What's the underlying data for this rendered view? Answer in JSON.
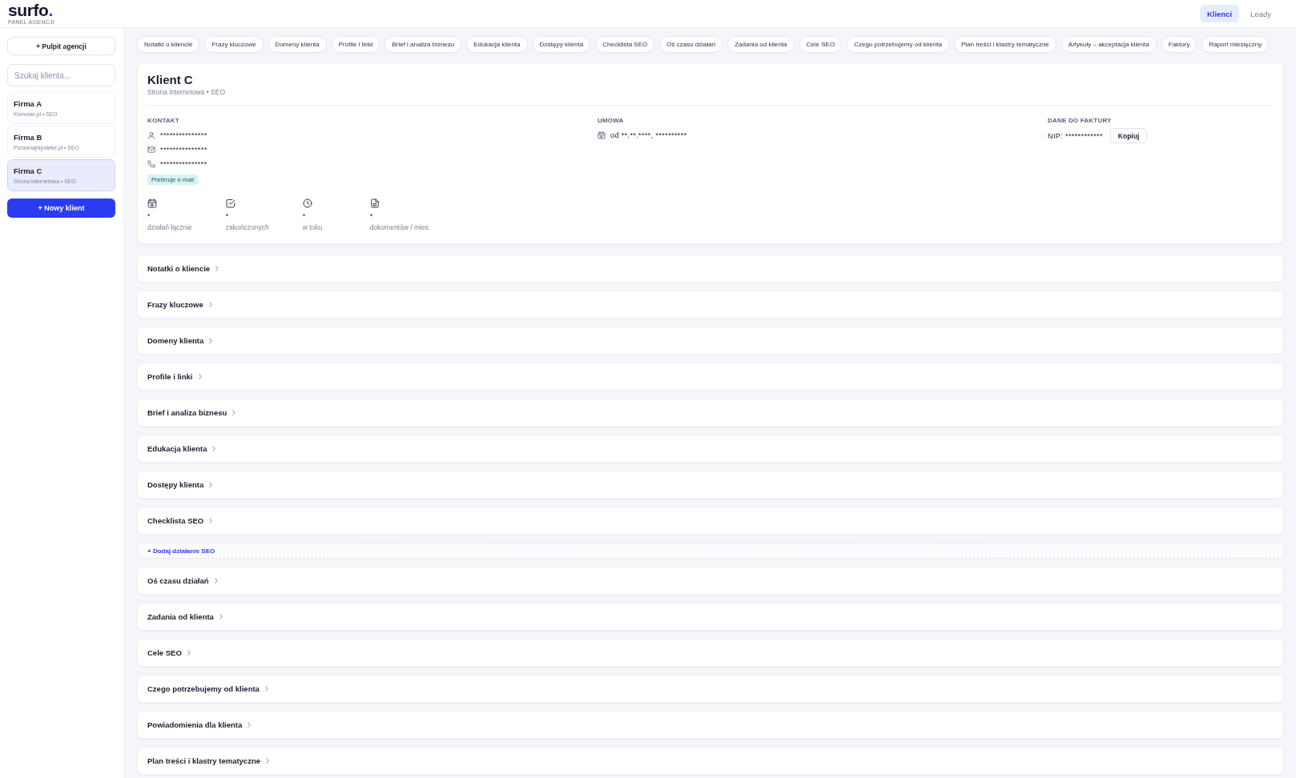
{
  "brand": {
    "name": "surfo",
    "dot": ".",
    "subtitle": "PANEL AGENCJI"
  },
  "top_nav": [
    {
      "label": "Klienci",
      "selected": true
    },
    {
      "label": "Leady",
      "selected": false
    }
  ],
  "sidebar": {
    "dashboard_button": "+ Pulpit agencji",
    "search": {
      "placeholder": "Szukaj klienta..."
    },
    "clients": [
      {
        "name": "Firma A",
        "subtitle": "Kronowo.pl • SEO",
        "selected": false
      },
      {
        "name": "Firma B",
        "subtitle": "Porównajhipoteke.pl • SEO",
        "selected": false
      },
      {
        "name": "Firma C",
        "subtitle": "Strona internetowa • SEO",
        "selected": true
      }
    ],
    "new_client_button": "+ Nowy klient"
  },
  "section_tabs": [
    "Notatki o kliencie",
    "Frazy kluczowe",
    "Domeny klienta",
    "Profile i linki",
    "Brief i analiza biznesu",
    "Edukacja klienta",
    "Dostępy klienta",
    "Checklista SEO",
    "Oś czasu działań",
    "Zadania od klienta",
    "Cele SEO",
    "Czego potrzebujemy od klienta",
    "Plan treści i klastry tematyczne",
    "Artykuły – akceptacja klienta",
    "Faktury",
    "Raport miesięczny"
  ],
  "client": {
    "name": "Klient C",
    "subtitle": "Strona internetowa • SEO",
    "contact": {
      "heading": "KONTAKT",
      "rows": [
        {
          "kind": "person",
          "value": "***************"
        },
        {
          "kind": "email",
          "value": "***************"
        },
        {
          "kind": "phone",
          "value": "***************"
        }
      ],
      "preference_badge": "Preferuje e-mail"
    },
    "contract": {
      "heading": "UMOWA",
      "value": "od **.**.****, **********"
    },
    "invoice": {
      "heading": "DANE DO FAKTURY",
      "nip": "NIP: ************",
      "copy_button": "Kopiuj"
    },
    "stats": [
      {
        "kind": "calendar",
        "value": "*",
        "label": "działań łącznie"
      },
      {
        "kind": "check",
        "value": "*",
        "label": "zakończonych"
      },
      {
        "kind": "clock",
        "value": "*",
        "label": "w toku"
      },
      {
        "kind": "document",
        "value": "*",
        "label": "dokumentów / mies."
      }
    ]
  },
  "sections": [
    {
      "kind": "section",
      "title": "Notatki o kliencie"
    },
    {
      "kind": "section",
      "title": "Frazy kluczowe"
    },
    {
      "kind": "section",
      "title": "Domeny klienta"
    },
    {
      "kind": "section",
      "title": "Profile i linki"
    },
    {
      "kind": "section",
      "title": "Brief i analiza biznesu"
    },
    {
      "kind": "section",
      "title": "Edukacja klienta"
    },
    {
      "kind": "section",
      "title": "Dostępy klienta"
    },
    {
      "kind": "section",
      "title": "Checklista SEO"
    },
    {
      "kind": "add_link",
      "title": "+ Dodaj działanie SEO"
    },
    {
      "kind": "section",
      "title": "Oś czasu działań"
    },
    {
      "kind": "section",
      "title": "Zadania od klienta"
    },
    {
      "kind": "section",
      "title": "Cele SEO"
    },
    {
      "kind": "section",
      "title": "Czego potrzebujemy od klienta"
    },
    {
      "kind": "section",
      "title": "Powiadomienia dla klienta"
    },
    {
      "kind": "section",
      "title": "Plan treści i klastry tematyczne"
    }
  ]
}
